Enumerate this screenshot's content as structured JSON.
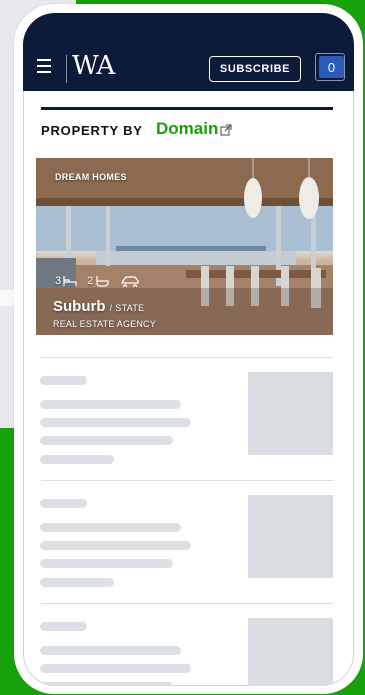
{
  "header": {
    "logo": "WA",
    "subscribe_label": "SUBSCRIBE",
    "counter": "0"
  },
  "section": {
    "property_by": "PROPERTY BY",
    "partner": "Domain"
  },
  "hero": {
    "tag": "DREAM HOMES",
    "beds": "3",
    "baths": "2",
    "suburb": "Suburb",
    "state": "/ STATE",
    "agency": "REAL ESTATE AGENCY"
  },
  "colors": {
    "navy": "#0d1b3a",
    "brand_green": "#17a10b",
    "counter_blue": "#2b5bb8",
    "skeleton": "#dcdfe3"
  }
}
